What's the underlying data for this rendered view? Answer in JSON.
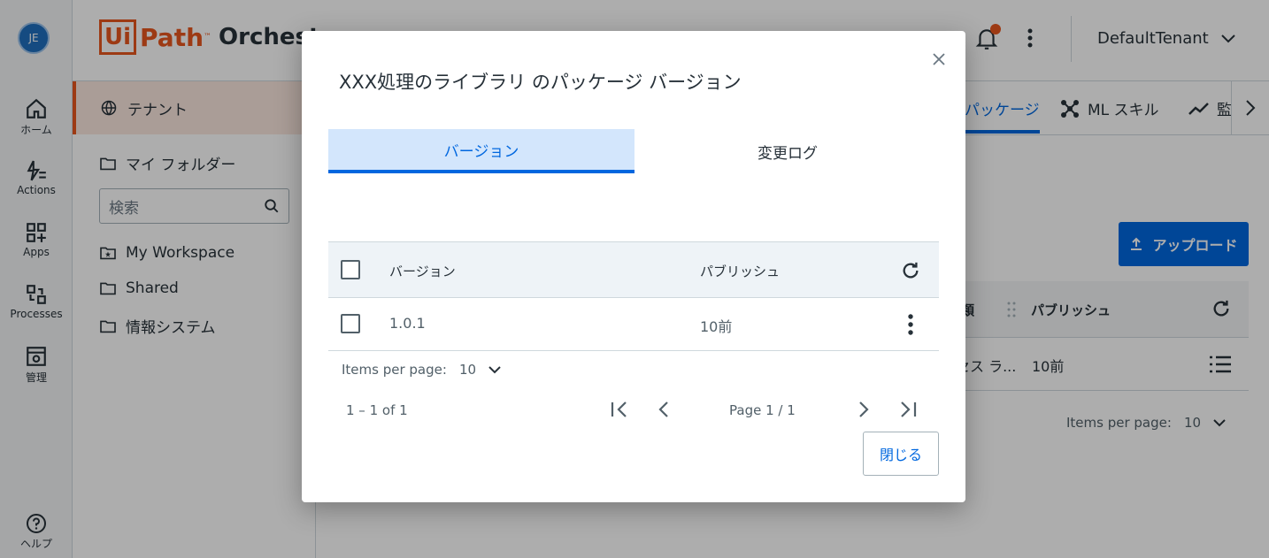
{
  "rail": {
    "avatar": "JE",
    "items": [
      {
        "label": "ホーム"
      },
      {
        "label": "Actions"
      },
      {
        "label": "Apps"
      },
      {
        "label": "Processes"
      },
      {
        "label": "管理"
      }
    ],
    "help": "ヘルプ"
  },
  "header": {
    "logo_ui": "Ui",
    "logo_path": "Path",
    "logo_tm": "™",
    "product": "Orchestr",
    "tenant": "DefaultTenant"
  },
  "folders": {
    "tenant": "テナント",
    "my_folder": "マイ フォルダー",
    "search_placeholder": "検索",
    "items": [
      "My Workspace",
      "Shared",
      "情報システム"
    ]
  },
  "main": {
    "tabs": [
      {
        "label": "パッケージ",
        "active": true
      },
      {
        "label": "ML スキル"
      },
      {
        "label": "監"
      }
    ],
    "upload": "アップロード",
    "table_headers": [
      "類",
      "パブリッシュ"
    ],
    "row": {
      "name": "セス ラ...",
      "published": "10前"
    },
    "items_per_page_label": "Items per page:",
    "items_per_page": "10"
  },
  "dialog": {
    "title": "XXX処理のライブラリ のパッケージ バージョン",
    "tabs": [
      {
        "label": "バージョン",
        "active": true
      },
      {
        "label": "変更ログ"
      }
    ],
    "table": {
      "headers": [
        "バージョン",
        "パブリッシュ"
      ],
      "rows": [
        {
          "version": "1.0.1",
          "published": "10前"
        }
      ]
    },
    "items_per_page_label": "Items per page:",
    "items_per_page": "10",
    "range": "1 – 1 of 1",
    "page": "Page 1 / 1",
    "close": "閉じる"
  },
  "colors": {
    "brand": "#e8561e",
    "accent": "#0067df"
  }
}
